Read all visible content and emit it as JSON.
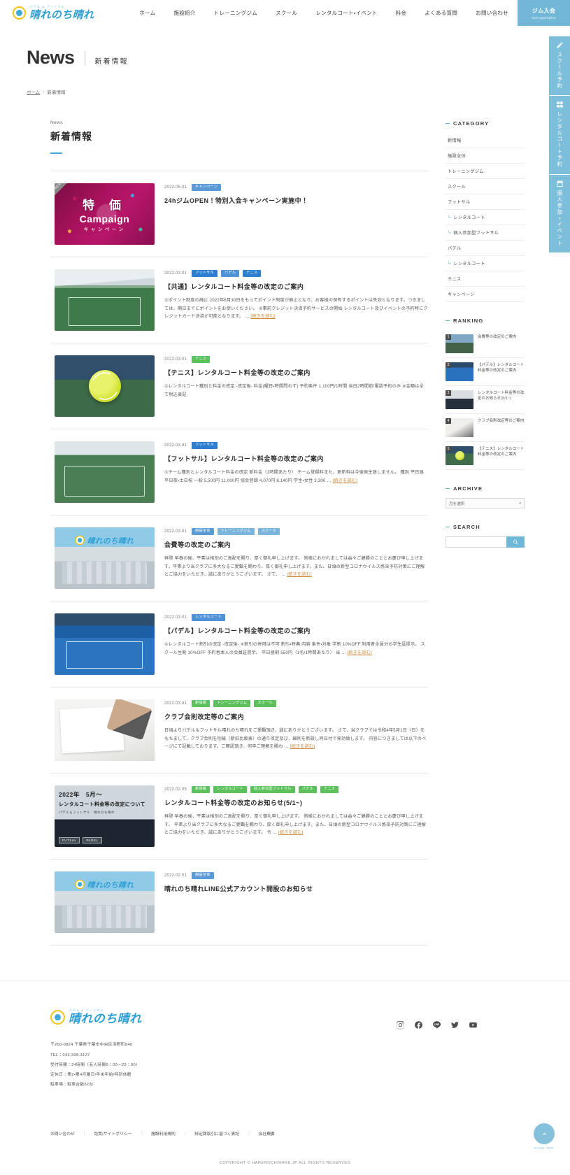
{
  "header": {
    "logo": {
      "sub": "パデル & フットサル",
      "main": "晴れのち晴れ"
    },
    "nav": [
      {
        "label": "ホーム"
      },
      {
        "label": "施設紹介"
      },
      {
        "label": "トレーニングジム"
      },
      {
        "label": "スクール"
      },
      {
        "label": "レンタルコート・イベント"
      },
      {
        "label": "料金"
      },
      {
        "label": "よくある質問"
      },
      {
        "label": "お問い合わせ"
      }
    ],
    "gym_button": {
      "jp": "ジム入会",
      "en": "Gym application"
    }
  },
  "side_tabs": [
    {
      "label": "スクール予約",
      "icon": "pencil-icon"
    },
    {
      "label": "レンタルコート予約",
      "icon": "grid-icon"
    },
    {
      "label": "個人参加・イベント",
      "icon": "calendar-icon"
    }
  ],
  "page_head": {
    "title_en": "News",
    "title_jp": "新着情報",
    "breadcrumb_home": "ホーム",
    "breadcrumb_sep": "›",
    "breadcrumb_current": "新着情報"
  },
  "section": {
    "label_en": "News",
    "label_jp": "新着情報"
  },
  "news": [
    {
      "date": "2022.05.01",
      "tags": [
        {
          "label": "キャンペーン",
          "color": "#5b9bd5"
        }
      ],
      "title": "24hジムOPEN！特別入会キャンペーン実施中！",
      "excerpt": "",
      "read_more": "",
      "thumb": "campaign",
      "new_flag": "NEW"
    },
    {
      "date": "2022.03.01",
      "tags": [
        {
          "label": "フットサル",
          "color": "#2f7fd1"
        },
        {
          "label": "パデル",
          "color": "#4f92d8"
        },
        {
          "label": "テニス",
          "color": "#2f7fd1"
        }
      ],
      "title": "【共通】レンタルコート料金等の改定のご案内",
      "excerpt": "①ポイント制度の廃止 2022年6月30日をもってポイント制度が廃止となり、お客様の保有するポイントは失効となります。つきましては、期日までにポイントをお使いください。 ②事前クレジット決済予約サービスの開始 レンタルコート及びイベントの予約時にクレジットカード決済が可能となります。 …",
      "read_more": "[続きを読む]",
      "thumb": "futsal"
    },
    {
      "date": "2022.03.01",
      "tags": [
        {
          "label": "テニス",
          "color": "#5cc05c"
        }
      ],
      "title": "【テニス】レンタルコート料金等の改定のご案内",
      "excerpt": "①レンタルコート種別と料金の改定 -改定後- 料金(曜日・時間問わず) 予約条件 1,100円/1時間 当日2時間前/電話予約のみ ※金額は全て税込表記",
      "read_more": "",
      "thumb": "tennis"
    },
    {
      "date": "2022.03.01",
      "tags": [
        {
          "label": "フットサル",
          "color": "#2f7fd1"
        }
      ],
      "title": "【フットサル】レンタルコート料金等の改定のご案内",
      "excerpt": "①チーム種別とレンタルコート料金の改定 新料金（1時間あたり） チーム登録料また、更新料は今後発生致しません。 種別 平日昼 平日夜・土日祝 一般 5,500円 11,000円 協会登録 4,070円 8,140円 学生・女性 3,300 …",
      "read_more": "[続きを読む]",
      "thumb": "futsal2"
    },
    {
      "date": "2022.03.01",
      "tags": [
        {
          "label": "施設全体",
          "color": "#5b9bd5"
        },
        {
          "label": "トレーニングジム",
          "color": "#79b4dd"
        },
        {
          "label": "スクール",
          "color": "#79b4dd"
        }
      ],
      "title": "会費等の改定のご案内",
      "excerpt": "拝啓 早春の候、平素は格別のご高配を賜り、厚く御礼申し上げます。 皆様におかれましては益々ご健勝のこととお慶び申し上げます。平素より当クラブに多大なるご愛顧を賜わり、厚く御礼申し上げます。また、日頃の新型コロナウイルス感染予防対策にご理解とご協力をいただき、誠にありがとうございます。 さて、 …",
      "read_more": "[続きを読む]",
      "thumb": "gym"
    },
    {
      "date": "2022.03.01",
      "tags": [
        {
          "label": "レンタルコート",
          "color": "#4f92d8"
        }
      ],
      "title": "【パデル】レンタルコート料金等の改定のご案内",
      "excerpt": "①レンタルコート割引の改定 -改定後- ※割引の併用は不可 割引・特典 内容 条件・対象 学割 10%OFF 利用者全員分の学生証提示。 スクール生割 10%OFF 予約者本人の会員証提示。 平日昼割 550円（1名/1時間あたり） 当 …",
      "read_more": "[続きを読む]",
      "thumb": "padel"
    },
    {
      "date": "2022.03.01",
      "tags": [
        {
          "label": "新情報",
          "color": "#5cc05c"
        },
        {
          "label": "トレーニングジム",
          "color": "#5cc05c"
        },
        {
          "label": "スクール",
          "color": "#5cc05c"
        }
      ],
      "title": "クラブ会則改定等のご案内",
      "excerpt": "日頃よりパデル＆フットサル晴れのち晴れをご愛顧頂き、誠にありがとうございます。 さて、当クラブでは令和4年5月1日（日）をもちまして、クラブ会則を別紙（新旧比較表）の通り改定及び、細則を新設し同日付で発効致します。 内容につきましては以下のページにて記載しております。ご確認頂き、何卒ご理解を賜わ …",
      "read_more": "[続きを読む]",
      "thumb": "sign"
    },
    {
      "date": "2022.02.05",
      "tags": [
        {
          "label": "新情報",
          "color": "#5cc05c"
        },
        {
          "label": "レンタルコート",
          "color": "#5cc05c"
        },
        {
          "label": "個人参加型フットサル",
          "color": "#5cc05c"
        },
        {
          "label": "パデル",
          "color": "#5cc05c"
        },
        {
          "label": "テニス",
          "color": "#5cc05c"
        }
      ],
      "title": "レンタルコート料金等の改定のお知らせ(5/1~)",
      "excerpt": "拝啓 早春の候、平素は格別のご高配を賜り、厚く御礼申し上げます。 皆様におかれましては益々ご健勝のこととお慶び申し上げます。 平素より当クラブに多大なるご愛顧を賜わり、厚く御礼申し上げます。また、日頃の新型コロナウイルス感染予防対策にご理解とご協力をいただき、誠にありがとうございます。 令 …",
      "read_more": "[続きを読む]",
      "thumb": "banner",
      "banner": {
        "line1": "2022年　5月〜",
        "line2": "レンタルコート料金等の改定について",
        "line3": "パデル＆フットサル　晴れのち晴れ",
        "chips": [
          "FUTSAL",
          "PADEL"
        ]
      }
    },
    {
      "date": "2022.02.01",
      "tags": [
        {
          "label": "施設全体",
          "color": "#5b9bd5"
        }
      ],
      "title": "晴れのち晴れLINE公式アカウント開設のお知らせ",
      "excerpt": "",
      "read_more": "",
      "thumb": "gym"
    }
  ],
  "sidebar": {
    "category": {
      "heading": "CATEGORY",
      "items": [
        {
          "label": "新情報",
          "sub": false
        },
        {
          "label": "施設全体",
          "sub": false
        },
        {
          "label": "トレーニングジム",
          "sub": false
        },
        {
          "label": "スクール",
          "sub": false
        },
        {
          "label": "フットサル",
          "sub": false
        },
        {
          "label": "レンタルコート",
          "sub": true
        },
        {
          "label": "個人参加型フットサル",
          "sub": true
        },
        {
          "label": "パデル",
          "sub": false
        },
        {
          "label": "レンタルコート",
          "sub": true
        },
        {
          "label": "テニス",
          "sub": false
        },
        {
          "label": "キャンペーン",
          "sub": false
        }
      ]
    },
    "ranking": {
      "heading": "RANKING",
      "items": [
        {
          "num": "1",
          "title": "会費等の改定のご案内",
          "thumb": "rk-a"
        },
        {
          "num": "2",
          "title": "【パデル】レンタルコート料金等の改定のご案内",
          "thumb": "rk-b"
        },
        {
          "num": "3",
          "title": "レンタルコート料金等の改定のお知らせ(5/1~)",
          "thumb": "rk-c"
        },
        {
          "num": "4",
          "title": "クラブ会則改定等のご案内",
          "thumb": "rk-d"
        },
        {
          "num": "5",
          "title": "【テニス】レンタルコート料金等の改定のご案内",
          "thumb": "rk-e"
        }
      ]
    },
    "archive": {
      "heading": "ARCHIVE",
      "selected": "月を選択"
    },
    "search": {
      "heading": "SEARCH",
      "value": "",
      "placeholder": "",
      "button_icon": "search-icon"
    }
  },
  "footer": {
    "logo": {
      "sub": "パデル & フットサル",
      "main": "晴れのち晴れ"
    },
    "address": [
      "〒260-0824 千葉県千葉市中央区浜野町840",
      "TEL：043-308-3137",
      "受付時間：24時間（有人時間9：00〜23：00）",
      "定休日：第2・第4月曜日/年末年始/特別休館",
      "駐車場：駐車台数82台"
    ],
    "socials": [
      {
        "name": "instagram-icon"
      },
      {
        "name": "facebook-icon"
      },
      {
        "name": "line-icon"
      },
      {
        "name": "twitter-icon"
      },
      {
        "name": "youtube-icon"
      }
    ],
    "links": [
      "お問い合わせ",
      "免責・サイトポリシー",
      "施設利用規則",
      "特定商取引に基づく表記",
      "会社概要"
    ],
    "link_sep": "|",
    "copyright": "COPYRIGHT © HARENOCHIHARE.JP ALL RIGHTS RESERVED",
    "page_top": "PAGE TOP"
  },
  "colors": {
    "brand_blue": "#2e9fd4",
    "accent_sky": "#72b8d6",
    "tag_blue": "#2f7fd1",
    "tag_green": "#5cc05c",
    "read_more": "#c98a3c"
  }
}
